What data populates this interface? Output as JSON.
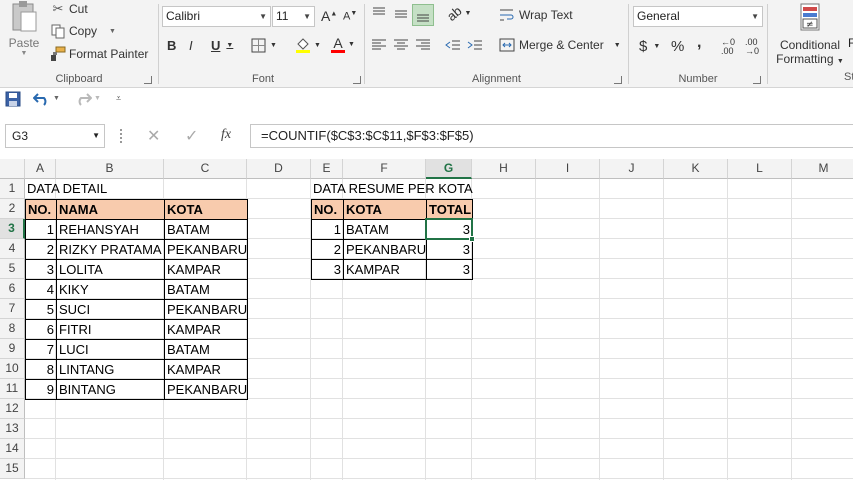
{
  "ribbon": {
    "clipboard": {
      "paste": "Paste",
      "cut": "Cut",
      "copy": "Copy",
      "format_painter": "Format Painter",
      "label": "Clipboard"
    },
    "font": {
      "name": "Calibri",
      "size": "11",
      "bold": "B",
      "italic": "I",
      "underline": "U",
      "label": "Font",
      "font_color": "#ff0000",
      "fill_color": "#ffff00"
    },
    "alignment": {
      "wrap_text": "Wrap Text",
      "merge_center": "Merge & Center",
      "label": "Alignment"
    },
    "number": {
      "format": "General",
      "currency": "$",
      "percent": "%",
      "comma": ",",
      "label": "Number"
    },
    "styles": {
      "conditional_line1": "Conditional",
      "conditional_line2": "Formatting",
      "next_cut1": "F",
      "next_cut2": "St"
    }
  },
  "formula_bar": {
    "name_box": "G3",
    "fx": "fx",
    "formula": "=COUNTIF($C$3:$C$11,$F$3:$F$5)"
  },
  "columns": [
    "A",
    "B",
    "C",
    "D",
    "E",
    "F",
    "G",
    "H",
    "I",
    "J",
    "K",
    "L",
    "M"
  ],
  "selected_column": "G",
  "rows": [
    "1",
    "2",
    "3",
    "4",
    "5",
    "6",
    "7",
    "8",
    "9",
    "10",
    "11",
    "12",
    "13",
    "14",
    "15"
  ],
  "selected_row": "3",
  "detail": {
    "title": "DATA DETAIL",
    "headers": [
      "NO.",
      "NAMA",
      "KOTA"
    ],
    "rows": [
      [
        "1",
        "REHANSYAH",
        "BATAM"
      ],
      [
        "2",
        "RIZKY PRATAMA",
        "PEKANBARU"
      ],
      [
        "3",
        "LOLITA",
        "KAMPAR"
      ],
      [
        "4",
        "KIKY",
        "BATAM"
      ],
      [
        "5",
        "SUCI",
        "PEKANBARU"
      ],
      [
        "6",
        "FITRI",
        "KAMPAR"
      ],
      [
        "7",
        "LUCI",
        "BATAM"
      ],
      [
        "8",
        "LINTANG",
        "KAMPAR"
      ],
      [
        "9",
        "BINTANG",
        "PEKANBARU"
      ]
    ]
  },
  "resume": {
    "title": "DATA RESUME PER KOTA",
    "headers": [
      "NO.",
      "KOTA",
      "TOTAL"
    ],
    "rows": [
      [
        "1",
        "BATAM",
        "3"
      ],
      [
        "2",
        "PEKANBARU",
        "3"
      ],
      [
        "3",
        "KAMPAR",
        "3"
      ]
    ]
  },
  "colors": {
    "header_fill": "#f8cbad",
    "excel_green": "#217346"
  }
}
